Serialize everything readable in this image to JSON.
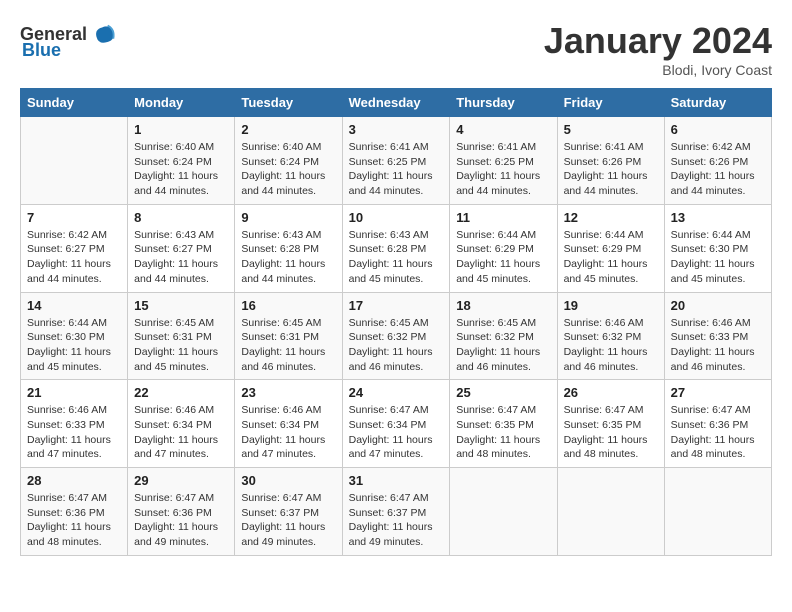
{
  "logo": {
    "general": "General",
    "blue": "Blue"
  },
  "header": {
    "month_year": "January 2024",
    "location": "Blodi, Ivory Coast"
  },
  "days_of_week": [
    "Sunday",
    "Monday",
    "Tuesday",
    "Wednesday",
    "Thursday",
    "Friday",
    "Saturday"
  ],
  "weeks": [
    [
      {
        "day": "",
        "sunrise": "",
        "sunset": "",
        "daylight": ""
      },
      {
        "day": "1",
        "sunrise": "Sunrise: 6:40 AM",
        "sunset": "Sunset: 6:24 PM",
        "daylight": "Daylight: 11 hours and 44 minutes."
      },
      {
        "day": "2",
        "sunrise": "Sunrise: 6:40 AM",
        "sunset": "Sunset: 6:24 PM",
        "daylight": "Daylight: 11 hours and 44 minutes."
      },
      {
        "day": "3",
        "sunrise": "Sunrise: 6:41 AM",
        "sunset": "Sunset: 6:25 PM",
        "daylight": "Daylight: 11 hours and 44 minutes."
      },
      {
        "day": "4",
        "sunrise": "Sunrise: 6:41 AM",
        "sunset": "Sunset: 6:25 PM",
        "daylight": "Daylight: 11 hours and 44 minutes."
      },
      {
        "day": "5",
        "sunrise": "Sunrise: 6:41 AM",
        "sunset": "Sunset: 6:26 PM",
        "daylight": "Daylight: 11 hours and 44 minutes."
      },
      {
        "day": "6",
        "sunrise": "Sunrise: 6:42 AM",
        "sunset": "Sunset: 6:26 PM",
        "daylight": "Daylight: 11 hours and 44 minutes."
      }
    ],
    [
      {
        "day": "7",
        "sunrise": "Sunrise: 6:42 AM",
        "sunset": "Sunset: 6:27 PM",
        "daylight": "Daylight: 11 hours and 44 minutes."
      },
      {
        "day": "8",
        "sunrise": "Sunrise: 6:43 AM",
        "sunset": "Sunset: 6:27 PM",
        "daylight": "Daylight: 11 hours and 44 minutes."
      },
      {
        "day": "9",
        "sunrise": "Sunrise: 6:43 AM",
        "sunset": "Sunset: 6:28 PM",
        "daylight": "Daylight: 11 hours and 44 minutes."
      },
      {
        "day": "10",
        "sunrise": "Sunrise: 6:43 AM",
        "sunset": "Sunset: 6:28 PM",
        "daylight": "Daylight: 11 hours and 45 minutes."
      },
      {
        "day": "11",
        "sunrise": "Sunrise: 6:44 AM",
        "sunset": "Sunset: 6:29 PM",
        "daylight": "Daylight: 11 hours and 45 minutes."
      },
      {
        "day": "12",
        "sunrise": "Sunrise: 6:44 AM",
        "sunset": "Sunset: 6:29 PM",
        "daylight": "Daylight: 11 hours and 45 minutes."
      },
      {
        "day": "13",
        "sunrise": "Sunrise: 6:44 AM",
        "sunset": "Sunset: 6:30 PM",
        "daylight": "Daylight: 11 hours and 45 minutes."
      }
    ],
    [
      {
        "day": "14",
        "sunrise": "Sunrise: 6:44 AM",
        "sunset": "Sunset: 6:30 PM",
        "daylight": "Daylight: 11 hours and 45 minutes."
      },
      {
        "day": "15",
        "sunrise": "Sunrise: 6:45 AM",
        "sunset": "Sunset: 6:31 PM",
        "daylight": "Daylight: 11 hours and 45 minutes."
      },
      {
        "day": "16",
        "sunrise": "Sunrise: 6:45 AM",
        "sunset": "Sunset: 6:31 PM",
        "daylight": "Daylight: 11 hours and 46 minutes."
      },
      {
        "day": "17",
        "sunrise": "Sunrise: 6:45 AM",
        "sunset": "Sunset: 6:32 PM",
        "daylight": "Daylight: 11 hours and 46 minutes."
      },
      {
        "day": "18",
        "sunrise": "Sunrise: 6:45 AM",
        "sunset": "Sunset: 6:32 PM",
        "daylight": "Daylight: 11 hours and 46 minutes."
      },
      {
        "day": "19",
        "sunrise": "Sunrise: 6:46 AM",
        "sunset": "Sunset: 6:32 PM",
        "daylight": "Daylight: 11 hours and 46 minutes."
      },
      {
        "day": "20",
        "sunrise": "Sunrise: 6:46 AM",
        "sunset": "Sunset: 6:33 PM",
        "daylight": "Daylight: 11 hours and 46 minutes."
      }
    ],
    [
      {
        "day": "21",
        "sunrise": "Sunrise: 6:46 AM",
        "sunset": "Sunset: 6:33 PM",
        "daylight": "Daylight: 11 hours and 47 minutes."
      },
      {
        "day": "22",
        "sunrise": "Sunrise: 6:46 AM",
        "sunset": "Sunset: 6:34 PM",
        "daylight": "Daylight: 11 hours and 47 minutes."
      },
      {
        "day": "23",
        "sunrise": "Sunrise: 6:46 AM",
        "sunset": "Sunset: 6:34 PM",
        "daylight": "Daylight: 11 hours and 47 minutes."
      },
      {
        "day": "24",
        "sunrise": "Sunrise: 6:47 AM",
        "sunset": "Sunset: 6:34 PM",
        "daylight": "Daylight: 11 hours and 47 minutes."
      },
      {
        "day": "25",
        "sunrise": "Sunrise: 6:47 AM",
        "sunset": "Sunset: 6:35 PM",
        "daylight": "Daylight: 11 hours and 48 minutes."
      },
      {
        "day": "26",
        "sunrise": "Sunrise: 6:47 AM",
        "sunset": "Sunset: 6:35 PM",
        "daylight": "Daylight: 11 hours and 48 minutes."
      },
      {
        "day": "27",
        "sunrise": "Sunrise: 6:47 AM",
        "sunset": "Sunset: 6:36 PM",
        "daylight": "Daylight: 11 hours and 48 minutes."
      }
    ],
    [
      {
        "day": "28",
        "sunrise": "Sunrise: 6:47 AM",
        "sunset": "Sunset: 6:36 PM",
        "daylight": "Daylight: 11 hours and 48 minutes."
      },
      {
        "day": "29",
        "sunrise": "Sunrise: 6:47 AM",
        "sunset": "Sunset: 6:36 PM",
        "daylight": "Daylight: 11 hours and 49 minutes."
      },
      {
        "day": "30",
        "sunrise": "Sunrise: 6:47 AM",
        "sunset": "Sunset: 6:37 PM",
        "daylight": "Daylight: 11 hours and 49 minutes."
      },
      {
        "day": "31",
        "sunrise": "Sunrise: 6:47 AM",
        "sunset": "Sunset: 6:37 PM",
        "daylight": "Daylight: 11 hours and 49 minutes."
      },
      {
        "day": "",
        "sunrise": "",
        "sunset": "",
        "daylight": ""
      },
      {
        "day": "",
        "sunrise": "",
        "sunset": "",
        "daylight": ""
      },
      {
        "day": "",
        "sunrise": "",
        "sunset": "",
        "daylight": ""
      }
    ]
  ]
}
